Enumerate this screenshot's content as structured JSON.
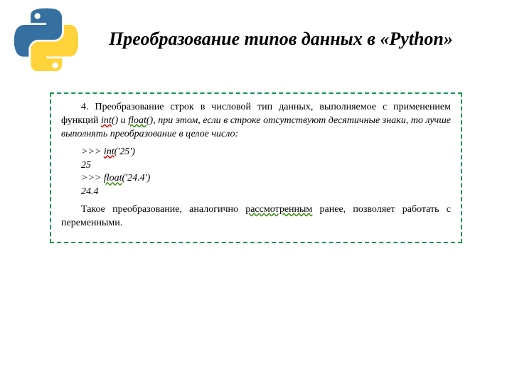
{
  "header": {
    "logo_name": "python-logo",
    "title": "Преобразование типов данных в «Python»"
  },
  "box": {
    "p1_a": "4. Преобразование строк в числовой тип данных, выполняемое с применением функций ",
    "p1_int": "int",
    "p1_b": "() и ",
    "p1_float": "float",
    "p1_c": "(), при этом, если в строке отсутствуют десятичные знаки, то лучше выполнять преобразование в целое число:",
    "code": {
      "l1_a": ">>> ",
      "l1_b": "int",
      "l1_c": "('25')",
      "l2": "25",
      "l3_a": ">>> ",
      "l3_b": "float",
      "l3_c": "('24.4')",
      "l4": "24.4"
    },
    "p2_a": "Такое преобразование, аналогично ",
    "p2_b": "рассмотренным",
    "p2_c": " ранее, позволяет работать с переменными."
  }
}
